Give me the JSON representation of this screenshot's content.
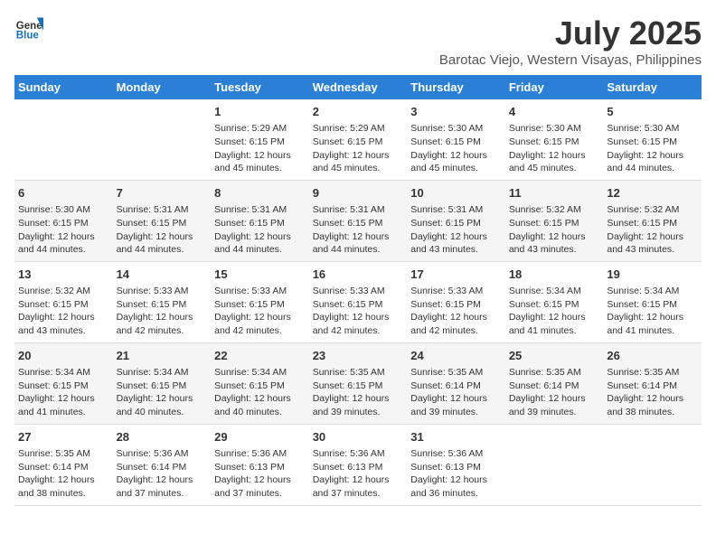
{
  "header": {
    "logo_line1": "General",
    "logo_line2": "Blue",
    "title": "July 2025",
    "subtitle": "Barotac Viejo, Western Visayas, Philippines"
  },
  "weekdays": [
    "Sunday",
    "Monday",
    "Tuesday",
    "Wednesday",
    "Thursday",
    "Friday",
    "Saturday"
  ],
  "weeks": [
    [
      {
        "day": "",
        "sunrise": "",
        "sunset": "",
        "daylight": ""
      },
      {
        "day": "",
        "sunrise": "",
        "sunset": "",
        "daylight": ""
      },
      {
        "day": "1",
        "sunrise": "Sunrise: 5:29 AM",
        "sunset": "Sunset: 6:15 PM",
        "daylight": "Daylight: 12 hours and 45 minutes."
      },
      {
        "day": "2",
        "sunrise": "Sunrise: 5:29 AM",
        "sunset": "Sunset: 6:15 PM",
        "daylight": "Daylight: 12 hours and 45 minutes."
      },
      {
        "day": "3",
        "sunrise": "Sunrise: 5:30 AM",
        "sunset": "Sunset: 6:15 PM",
        "daylight": "Daylight: 12 hours and 45 minutes."
      },
      {
        "day": "4",
        "sunrise": "Sunrise: 5:30 AM",
        "sunset": "Sunset: 6:15 PM",
        "daylight": "Daylight: 12 hours and 45 minutes."
      },
      {
        "day": "5",
        "sunrise": "Sunrise: 5:30 AM",
        "sunset": "Sunset: 6:15 PM",
        "daylight": "Daylight: 12 hours and 44 minutes."
      }
    ],
    [
      {
        "day": "6",
        "sunrise": "Sunrise: 5:30 AM",
        "sunset": "Sunset: 6:15 PM",
        "daylight": "Daylight: 12 hours and 44 minutes."
      },
      {
        "day": "7",
        "sunrise": "Sunrise: 5:31 AM",
        "sunset": "Sunset: 6:15 PM",
        "daylight": "Daylight: 12 hours and 44 minutes."
      },
      {
        "day": "8",
        "sunrise": "Sunrise: 5:31 AM",
        "sunset": "Sunset: 6:15 PM",
        "daylight": "Daylight: 12 hours and 44 minutes."
      },
      {
        "day": "9",
        "sunrise": "Sunrise: 5:31 AM",
        "sunset": "Sunset: 6:15 PM",
        "daylight": "Daylight: 12 hours and 44 minutes."
      },
      {
        "day": "10",
        "sunrise": "Sunrise: 5:31 AM",
        "sunset": "Sunset: 6:15 PM",
        "daylight": "Daylight: 12 hours and 43 minutes."
      },
      {
        "day": "11",
        "sunrise": "Sunrise: 5:32 AM",
        "sunset": "Sunset: 6:15 PM",
        "daylight": "Daylight: 12 hours and 43 minutes."
      },
      {
        "day": "12",
        "sunrise": "Sunrise: 5:32 AM",
        "sunset": "Sunset: 6:15 PM",
        "daylight": "Daylight: 12 hours and 43 minutes."
      }
    ],
    [
      {
        "day": "13",
        "sunrise": "Sunrise: 5:32 AM",
        "sunset": "Sunset: 6:15 PM",
        "daylight": "Daylight: 12 hours and 43 minutes."
      },
      {
        "day": "14",
        "sunrise": "Sunrise: 5:33 AM",
        "sunset": "Sunset: 6:15 PM",
        "daylight": "Daylight: 12 hours and 42 minutes."
      },
      {
        "day": "15",
        "sunrise": "Sunrise: 5:33 AM",
        "sunset": "Sunset: 6:15 PM",
        "daylight": "Daylight: 12 hours and 42 minutes."
      },
      {
        "day": "16",
        "sunrise": "Sunrise: 5:33 AM",
        "sunset": "Sunset: 6:15 PM",
        "daylight": "Daylight: 12 hours and 42 minutes."
      },
      {
        "day": "17",
        "sunrise": "Sunrise: 5:33 AM",
        "sunset": "Sunset: 6:15 PM",
        "daylight": "Daylight: 12 hours and 42 minutes."
      },
      {
        "day": "18",
        "sunrise": "Sunrise: 5:34 AM",
        "sunset": "Sunset: 6:15 PM",
        "daylight": "Daylight: 12 hours and 41 minutes."
      },
      {
        "day": "19",
        "sunrise": "Sunrise: 5:34 AM",
        "sunset": "Sunset: 6:15 PM",
        "daylight": "Daylight: 12 hours and 41 minutes."
      }
    ],
    [
      {
        "day": "20",
        "sunrise": "Sunrise: 5:34 AM",
        "sunset": "Sunset: 6:15 PM",
        "daylight": "Daylight: 12 hours and 41 minutes."
      },
      {
        "day": "21",
        "sunrise": "Sunrise: 5:34 AM",
        "sunset": "Sunset: 6:15 PM",
        "daylight": "Daylight: 12 hours and 40 minutes."
      },
      {
        "day": "22",
        "sunrise": "Sunrise: 5:34 AM",
        "sunset": "Sunset: 6:15 PM",
        "daylight": "Daylight: 12 hours and 40 minutes."
      },
      {
        "day": "23",
        "sunrise": "Sunrise: 5:35 AM",
        "sunset": "Sunset: 6:15 PM",
        "daylight": "Daylight: 12 hours and 39 minutes."
      },
      {
        "day": "24",
        "sunrise": "Sunrise: 5:35 AM",
        "sunset": "Sunset: 6:14 PM",
        "daylight": "Daylight: 12 hours and 39 minutes."
      },
      {
        "day": "25",
        "sunrise": "Sunrise: 5:35 AM",
        "sunset": "Sunset: 6:14 PM",
        "daylight": "Daylight: 12 hours and 39 minutes."
      },
      {
        "day": "26",
        "sunrise": "Sunrise: 5:35 AM",
        "sunset": "Sunset: 6:14 PM",
        "daylight": "Daylight: 12 hours and 38 minutes."
      }
    ],
    [
      {
        "day": "27",
        "sunrise": "Sunrise: 5:35 AM",
        "sunset": "Sunset: 6:14 PM",
        "daylight": "Daylight: 12 hours and 38 minutes."
      },
      {
        "day": "28",
        "sunrise": "Sunrise: 5:36 AM",
        "sunset": "Sunset: 6:14 PM",
        "daylight": "Daylight: 12 hours and 37 minutes."
      },
      {
        "day": "29",
        "sunrise": "Sunrise: 5:36 AM",
        "sunset": "Sunset: 6:13 PM",
        "daylight": "Daylight: 12 hours and 37 minutes."
      },
      {
        "day": "30",
        "sunrise": "Sunrise: 5:36 AM",
        "sunset": "Sunset: 6:13 PM",
        "daylight": "Daylight: 12 hours and 37 minutes."
      },
      {
        "day": "31",
        "sunrise": "Sunrise: 5:36 AM",
        "sunset": "Sunset: 6:13 PM",
        "daylight": "Daylight: 12 hours and 36 minutes."
      },
      {
        "day": "",
        "sunrise": "",
        "sunset": "",
        "daylight": ""
      },
      {
        "day": "",
        "sunrise": "",
        "sunset": "",
        "daylight": ""
      }
    ]
  ]
}
